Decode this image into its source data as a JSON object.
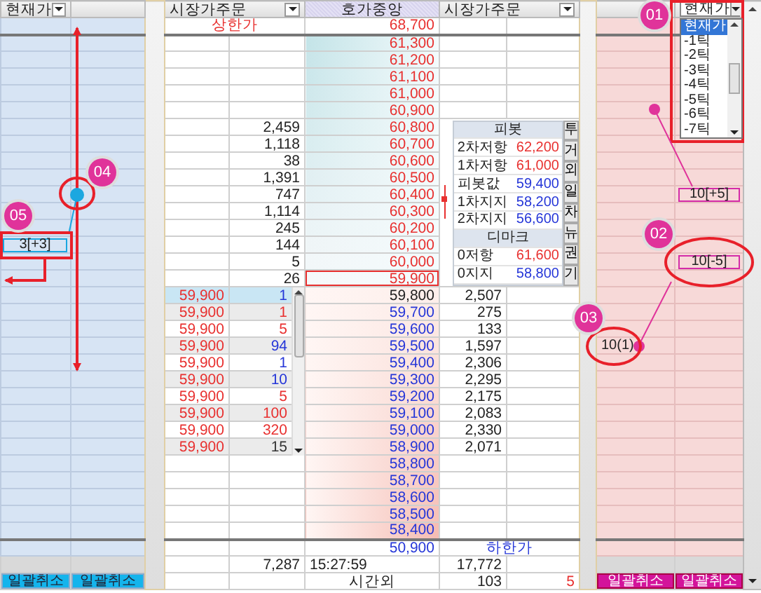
{
  "left_panel": {
    "header": "현재가",
    "buttons": [
      "일괄취소",
      "일괄취소"
    ]
  },
  "market_order_left": {
    "header": "시장가주문"
  },
  "center": {
    "header": "호가중앙"
  },
  "market_order_right": {
    "header": "시장가주문"
  },
  "right_panel": {
    "dropdown": {
      "value": "현재가",
      "open": true,
      "options": [
        {
          "label": "현재가",
          "selected": true
        },
        {
          "label": "-1틱",
          "selected": false
        },
        {
          "label": "-2틱",
          "selected": false
        },
        {
          "label": "-3틱",
          "selected": false
        },
        {
          "label": "-4틱",
          "selected": false
        },
        {
          "label": "-5틱",
          "selected": false
        },
        {
          "label": "-6틱",
          "selected": false
        },
        {
          "label": "-7틱",
          "selected": false
        }
      ]
    },
    "buttons": [
      "일괄취소",
      "일괄취소"
    ]
  },
  "upper_limit": {
    "label": "상한가",
    "price": "68,700"
  },
  "ladder": {
    "rows": [
      {
        "price": "61,300",
        "color": "#e8302f",
        "kind": "ask",
        "current": false
      },
      {
        "price": "61,200",
        "color": "#e8302f",
        "kind": "ask",
        "current": false
      },
      {
        "price": "61,100",
        "color": "#e8302f",
        "kind": "ask",
        "current": false
      },
      {
        "price": "61,000",
        "color": "#e8302f",
        "kind": "ask",
        "current": false
      },
      {
        "price": "60,900",
        "color": "#e8302f",
        "kind": "ask",
        "current": false
      },
      {
        "price": "60,800",
        "color": "#e8302f",
        "kind": "ask",
        "current": false,
        "ask_qty": "2,459"
      },
      {
        "price": "60,700",
        "color": "#e8302f",
        "kind": "ask",
        "current": false,
        "ask_qty": "1,118"
      },
      {
        "price": "60,600",
        "color": "#e8302f",
        "kind": "ask",
        "current": false,
        "ask_qty": "38"
      },
      {
        "price": "60,500",
        "color": "#e8302f",
        "kind": "ask",
        "current": false,
        "ask_qty": "1,391"
      },
      {
        "price": "60,400",
        "color": "#e8302f",
        "kind": "ask",
        "current": false,
        "ask_qty": "747",
        "right_b": {
          "text": "10[+5]",
          "boxed": true
        }
      },
      {
        "price": "60,300",
        "color": "#e8302f",
        "kind": "ask",
        "current": false,
        "ask_qty": "1,114"
      },
      {
        "price": "60,200",
        "color": "#e8302f",
        "kind": "ask",
        "current": false,
        "ask_qty": "245"
      },
      {
        "price": "60,100",
        "color": "#e8302f",
        "kind": "ask",
        "current": false,
        "ask_qty": "144",
        "left_mark": {
          "text": "3[+3]",
          "boxed": true
        }
      },
      {
        "price": "60,000",
        "color": "#e8302f",
        "kind": "ask",
        "current": false,
        "ask_qty": "5",
        "right_b": {
          "text": "10[-5]",
          "boxed": true
        }
      },
      {
        "price": "59,900",
        "color": "#e8302f",
        "kind": "ask",
        "current": true,
        "ask_qty": "26"
      },
      {
        "price": "59,800",
        "color": "#222222",
        "kind": "bid",
        "current": false,
        "bid_qty": "2,507",
        "order": {
          "price": "59,900",
          "qty": "1",
          "color": "#2536d8",
          "selected": true
        }
      },
      {
        "price": "59,700",
        "color": "#2536d8",
        "kind": "bid",
        "current": false,
        "bid_qty": "275",
        "order": {
          "price": "59,900",
          "qty": "1",
          "color": "#e8302f",
          "selected": false
        }
      },
      {
        "price": "59,600",
        "color": "#2536d8",
        "kind": "bid",
        "current": false,
        "bid_qty": "133",
        "order": {
          "price": "59,900",
          "qty": "5",
          "color": "#e8302f",
          "selected": false
        }
      },
      {
        "price": "59,500",
        "color": "#2536d8",
        "kind": "bid",
        "current": false,
        "bid_qty": "1,597",
        "order": {
          "price": "59,900",
          "qty": "94",
          "color": "#2536d8",
          "selected": false
        },
        "right_a": {
          "text": "10(1)",
          "boxed": false
        }
      },
      {
        "price": "59,400",
        "color": "#2536d8",
        "kind": "bid",
        "current": false,
        "bid_qty": "2,306",
        "order": {
          "price": "59,900",
          "qty": "1",
          "color": "#2536d8",
          "selected": false
        }
      },
      {
        "price": "59,300",
        "color": "#2536d8",
        "kind": "bid",
        "current": false,
        "bid_qty": "2,295",
        "order": {
          "price": "59,900",
          "qty": "10",
          "color": "#2536d8",
          "selected": false
        }
      },
      {
        "price": "59,200",
        "color": "#2536d8",
        "kind": "bid",
        "current": false,
        "bid_qty": "2,175",
        "order": {
          "price": "59,900",
          "qty": "5",
          "color": "#e8302f",
          "selected": false
        }
      },
      {
        "price": "59,100",
        "color": "#2536d8",
        "kind": "bid",
        "current": false,
        "bid_qty": "2,083",
        "order": {
          "price": "59,900",
          "qty": "100",
          "color": "#e8302f",
          "selected": false
        }
      },
      {
        "price": "59,000",
        "color": "#2536d8",
        "kind": "bid",
        "current": false,
        "bid_qty": "2,330",
        "order": {
          "price": "59,900",
          "qty": "320",
          "color": "#e8302f",
          "selected": false
        }
      },
      {
        "price": "58,900",
        "color": "#2536d8",
        "kind": "bid",
        "current": false,
        "bid_qty": "2,071",
        "order": {
          "price": "59,900",
          "qty": "15",
          "color": "#333333",
          "selected": false
        }
      },
      {
        "price": "58,800",
        "color": "#2536d8",
        "kind": "bid",
        "current": false
      },
      {
        "price": "58,700",
        "color": "#2536d8",
        "kind": "bid",
        "current": false
      },
      {
        "price": "58,600",
        "color": "#2536d8",
        "kind": "bid",
        "current": false
      },
      {
        "price": "58,500",
        "color": "#2536d8",
        "kind": "bid",
        "current": false
      },
      {
        "price": "58,400",
        "color": "#2536d8",
        "kind": "bid",
        "current": false
      }
    ]
  },
  "pivot": {
    "title": "피봇",
    "rows": [
      {
        "label": "2차저항",
        "value": "62,200",
        "color": "#e8302f"
      },
      {
        "label": "1차저항",
        "value": "61,000",
        "color": "#e8302f"
      },
      {
        "label": "피봇값",
        "value": "59,400",
        "color": "#2536d8"
      },
      {
        "label": "1차지지",
        "value": "58,200",
        "color": "#2536d8"
      },
      {
        "label": "2차지지",
        "value": "56,600",
        "color": "#2536d8"
      }
    ],
    "dmark_title": "디마크",
    "dmark_rows": [
      {
        "label": "0저항",
        "value": "61,600",
        "color": "#e8302f"
      },
      {
        "label": "0지지",
        "value": "58,800",
        "color": "#2536d8"
      }
    ],
    "tabs": [
      {
        "label": "투",
        "selected": false
      },
      {
        "label": "거",
        "selected": false
      },
      {
        "label": "외",
        "selected": false
      },
      {
        "label": "일",
        "selected": false
      },
      {
        "label": "차",
        "selected": false
      },
      {
        "label": "뉴",
        "selected": false
      },
      {
        "label": "권",
        "selected": false
      },
      {
        "label": "기",
        "selected": false
      }
    ]
  },
  "lower_limit": {
    "price": "50,900",
    "label": "하한가"
  },
  "totals": {
    "ask_total": "7,287",
    "time": "15:27:59",
    "bid_total": "17,772"
  },
  "after_hours": {
    "label": "시간외",
    "bid_qty": "103",
    "count": "5"
  },
  "annotations": [
    {
      "label": "01"
    },
    {
      "label": "02"
    },
    {
      "label": "03"
    },
    {
      "label": "04"
    },
    {
      "label": "05"
    }
  ]
}
